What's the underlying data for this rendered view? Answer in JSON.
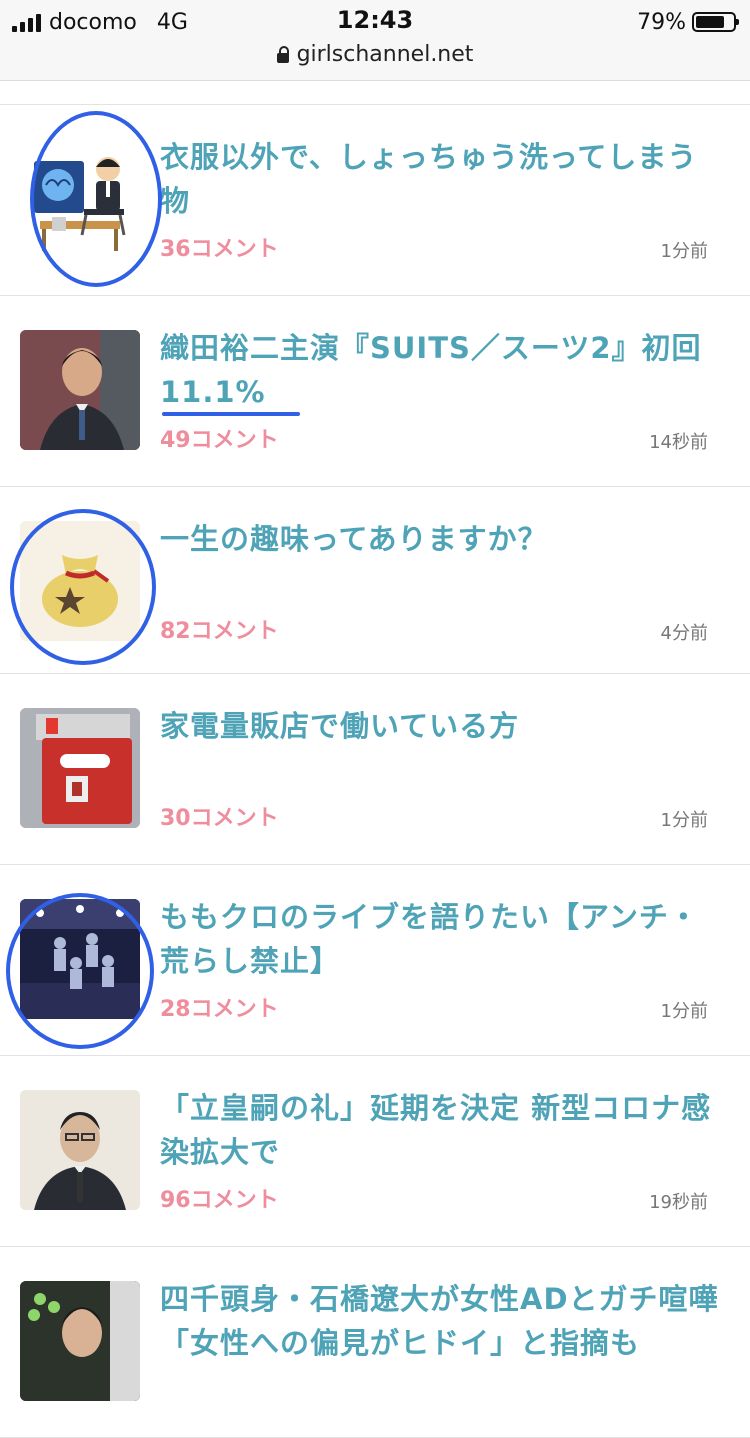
{
  "status_bar": {
    "carrier": "docomo",
    "network": "4G",
    "time": "12:43",
    "battery": "79%",
    "battery_level": 0.79,
    "url": "girlschannel.net"
  },
  "colors": {
    "title": "#4fa3b7",
    "comments": "#ef8d9c",
    "annotation": "#2f60e6"
  },
  "topics": [
    {
      "title": "衣服以外で、しょっちゅう洗ってしまう物",
      "comments": "36コメント",
      "time": "1分前",
      "thumb_icon": "office-worker-illustration-icon"
    },
    {
      "title": "織田裕二主演『SUITS／スーツ2』初回11.1%",
      "comments": "49コメント",
      "time": "14秒前",
      "thumb_icon": "actor-photo"
    },
    {
      "title": "一生の趣味ってありますか？",
      "comments": "82コメント",
      "time": "4分前",
      "thumb_icon": "money-bag-icon"
    },
    {
      "title": "家電量販店で働いている方",
      "comments": "30コメント",
      "time": "1分前",
      "thumb_icon": "nintendo-switch-box-photo"
    },
    {
      "title": "ももクロのライブを語りたい【アンチ・荒らし禁止】",
      "comments": "28コメント",
      "time": "1分前",
      "thumb_icon": "live-stage-photo"
    },
    {
      "title": "「立皇嗣の礼」延期を決定 新型コロナ感染拡大で",
      "comments": "96コメント",
      "time": "19秒前",
      "thumb_icon": "man-portrait-photo"
    },
    {
      "title": "四千頭身・石橋遼大が女性ADとガチ喧嘩　「女性への偏見がヒドイ」と指摘も",
      "comments": "",
      "time": "",
      "thumb_icon": "man-portrait-photo"
    }
  ]
}
